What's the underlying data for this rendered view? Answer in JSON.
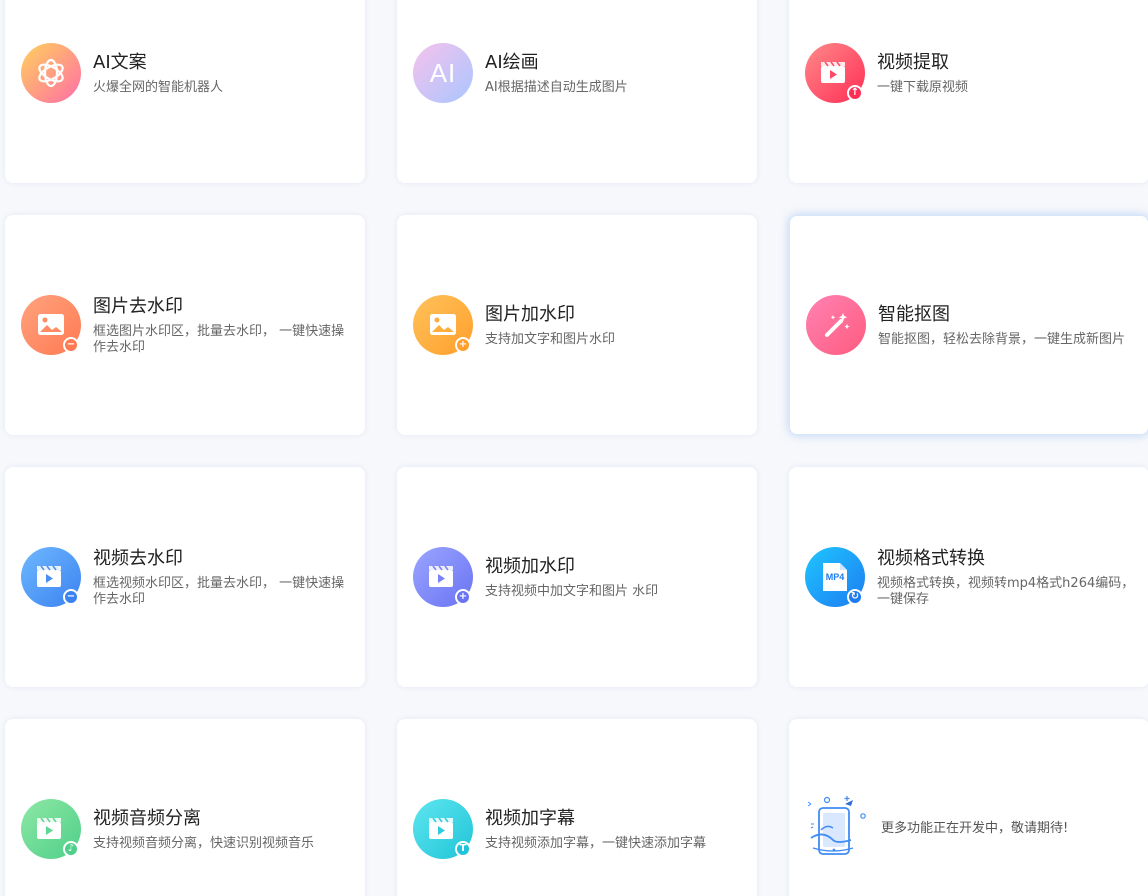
{
  "cards": [
    {
      "title": "AI文案",
      "desc": "火爆全网的智能机器人",
      "icon": "openai-logo-icon",
      "color_start": "#ffd15c",
      "color_end": "#ff6ea7"
    },
    {
      "title": "AI绘画",
      "desc": "AI根据描述自动生成图片",
      "icon": "ai-text-icon",
      "icon_text": "AI",
      "color_start": "#f6c2ec",
      "color_end": "#a9c6ff"
    },
    {
      "title": "视频提取",
      "desc": "一键下载原视频",
      "icon": "video-download-icon",
      "color_start": "#ff8a8a",
      "color_end": "#ff2e55"
    },
    {
      "title": "图片去水印",
      "desc": "框选图片水印区，批量去水印， 一键快速操作去水印",
      "icon": "image-remove-icon",
      "color_start": "#ffa37e",
      "color_end": "#ff7a52"
    },
    {
      "title": "图片加水印",
      "desc": "支持加文字和图片水印",
      "icon": "image-add-icon",
      "color_start": "#ffc25a",
      "color_end": "#ff9f2c"
    },
    {
      "title": "智能抠图",
      "desc": "智能抠图，轻松去除背景，一键生成新图片",
      "icon": "magic-wand-icon",
      "color_start": "#ff82b4",
      "color_end": "#ff5b7e"
    },
    {
      "title": "视频去水印",
      "desc": "框选视频水印区，批量去水印， 一键快速操作去水印",
      "icon": "video-remove-icon",
      "color_start": "#6fb8ff",
      "color_end": "#3b82f0"
    },
    {
      "title": "视频加水印",
      "desc": "支持视频中加文字和图片 水印",
      "icon": "video-add-icon",
      "color_start": "#9aa5ff",
      "color_end": "#6a73f2"
    },
    {
      "title": "视频格式转换",
      "desc": "视频格式转换，视频转mp4格式h264编码，一键保存",
      "icon": "mp4-file-icon",
      "icon_text": "MP4",
      "color_start": "#1fc7ff",
      "color_end": "#1d7bf2"
    },
    {
      "title": "视频音频分离",
      "desc": "支持视频音频分离，快速识别视频音乐",
      "icon": "video-audio-icon",
      "color_start": "#8de8a4",
      "color_end": "#4fcf8a"
    },
    {
      "title": "视频加字幕",
      "desc": "支持视频添加字幕，一键快速添加字幕",
      "icon": "video-subtitle-icon",
      "badge_text": "T",
      "color_start": "#5ee6ef",
      "color_end": "#20c4d8"
    },
    {
      "title": "",
      "desc": "更多功能正在开发中，敬请期待!",
      "icon": "coming-soon-illustration-icon",
      "color_start": "#3f8cf5",
      "color_end": "#3f8cf5"
    }
  ],
  "colors": {
    "title": "#222222",
    "desc": "#666666",
    "card_bg": "#ffffff",
    "page_bg": "#f7f8fb"
  }
}
